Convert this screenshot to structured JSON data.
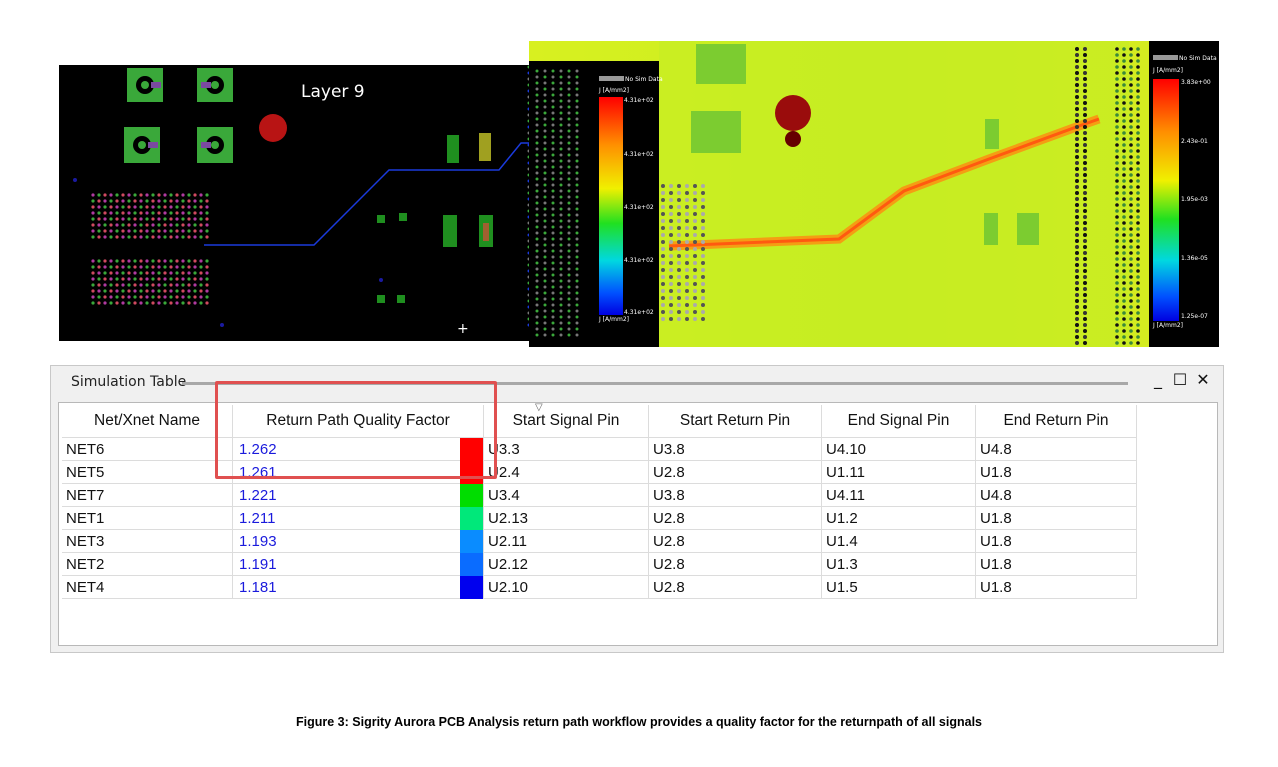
{
  "layout_view": {
    "layer_label": "Layer 9"
  },
  "heatmap_view": {
    "left_scale": {
      "no_sim_label": "No Sim Data",
      "unit_top": "J [A/mm2]",
      "unit_bottom": "J [A/mm2]",
      "ticks": [
        "4.31e+02",
        "4.31e+02",
        "4.31e+02",
        "4.31e+02",
        "4.31e+02"
      ]
    },
    "right_scale": {
      "no_sim_label": "No Sim Data",
      "unit_top": "J [A/mm2]",
      "unit_bottom": "J [A/mm2]",
      "ticks": [
        "3.83e+00",
        "2.43e-01",
        "1.95e-03",
        "1.36e-05",
        "1.25e-07"
      ]
    }
  },
  "simulation_table": {
    "title": "Simulation Table",
    "controls": {
      "minimize": "_",
      "maximize": "☐",
      "close": "✕"
    },
    "columns": [
      "Net/Xnet Name",
      "Return Path Quality Factor",
      "Start Signal Pin",
      "Start Return Pin",
      "End Signal Pin",
      "End Return Pin"
    ],
    "rows": [
      {
        "net": "NET6",
        "quality": "1.262",
        "color": "#ff0000",
        "start_signal": "U3.3",
        "start_return": "U3.8",
        "end_signal": "U4.10",
        "end_return": "U4.8"
      },
      {
        "net": "NET5",
        "quality": "1.261",
        "color": "#ff0000",
        "start_signal": "U2.4",
        "start_return": "U2.8",
        "end_signal": "U1.11",
        "end_return": "U1.8"
      },
      {
        "net": "NET7",
        "quality": "1.221",
        "color": "#00dd00",
        "start_signal": "U3.4",
        "start_return": "U3.8",
        "end_signal": "U4.11",
        "end_return": "U4.8"
      },
      {
        "net": "NET1",
        "quality": "1.211",
        "color": "#00e87a",
        "start_signal": "U2.13",
        "start_return": "U2.8",
        "end_signal": "U1.2",
        "end_return": "U1.8"
      },
      {
        "net": "NET3",
        "quality": "1.193",
        "color": "#0a8cff",
        "start_signal": "U2.11",
        "start_return": "U2.8",
        "end_signal": "U1.4",
        "end_return": "U1.8"
      },
      {
        "net": "NET2",
        "quality": "1.191",
        "color": "#0a6cff",
        "start_signal": "U2.12",
        "start_return": "U2.8",
        "end_signal": "U1.3",
        "end_return": "U1.8"
      },
      {
        "net": "NET4",
        "quality": "1.181",
        "color": "#0000ee",
        "start_signal": "U2.10",
        "start_return": "U2.8",
        "end_signal": "U1.5",
        "end_return": "U1.8"
      }
    ]
  },
  "caption": "Figure 3: Sigrity Aurora PCB Analysis return path workflow provides a quality factor for the returnpath of all signals"
}
